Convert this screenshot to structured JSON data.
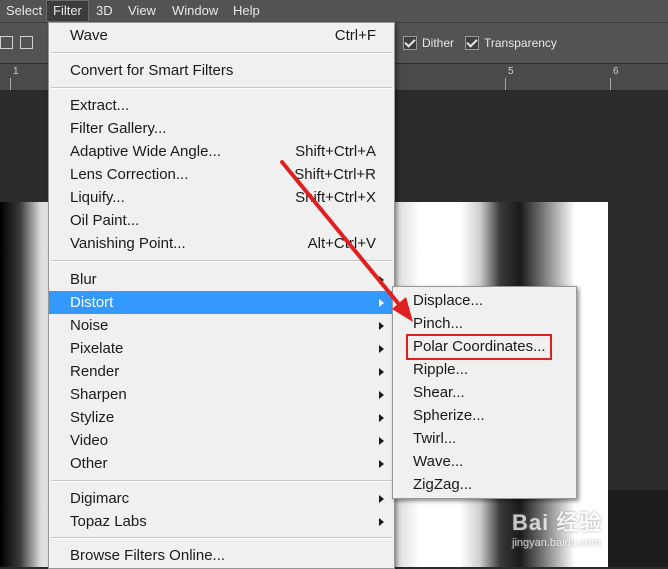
{
  "menubar": {
    "items": [
      {
        "label": "Select"
      },
      {
        "label": "Filter"
      },
      {
        "label": "3D"
      },
      {
        "label": "View"
      },
      {
        "label": "Window"
      },
      {
        "label": "Help"
      }
    ]
  },
  "options": {
    "dither_label": "Dither",
    "transparency_label": "Transparency",
    "dither_checked": true,
    "transparency_checked": true
  },
  "ruler": {
    "labels": [
      "1",
      "5",
      "6"
    ]
  },
  "filter_menu": {
    "items": [
      {
        "label": "Wave",
        "shortcut": "Ctrl+F"
      },
      {
        "label": "Convert for Smart Filters"
      },
      {
        "label": "Extract..."
      },
      {
        "label": "Filter Gallery..."
      },
      {
        "label": "Adaptive Wide Angle...",
        "shortcut": "Shift+Ctrl+A"
      },
      {
        "label": "Lens Correction...",
        "shortcut": "Shift+Ctrl+R"
      },
      {
        "label": "Liquify...",
        "shortcut": "Shift+Ctrl+X"
      },
      {
        "label": "Oil Paint..."
      },
      {
        "label": "Vanishing Point...",
        "shortcut": "Alt+Ctrl+V"
      },
      {
        "label": "Blur"
      },
      {
        "label": "Distort"
      },
      {
        "label": "Noise"
      },
      {
        "label": "Pixelate"
      },
      {
        "label": "Render"
      },
      {
        "label": "Sharpen"
      },
      {
        "label": "Stylize"
      },
      {
        "label": "Video"
      },
      {
        "label": "Other"
      },
      {
        "label": "Digimarc"
      },
      {
        "label": "Topaz Labs"
      },
      {
        "label": "Browse Filters Online..."
      }
    ]
  },
  "distort_submenu": {
    "items": [
      {
        "label": "Displace..."
      },
      {
        "label": "Pinch..."
      },
      {
        "label": "Polar Coordinates..."
      },
      {
        "label": "Ripple..."
      },
      {
        "label": "Shear..."
      },
      {
        "label": "Spherize..."
      },
      {
        "label": "Twirl..."
      },
      {
        "label": "Wave..."
      },
      {
        "label": "ZigZag..."
      }
    ]
  },
  "watermark": {
    "text": "Bai 经验",
    "sub": "jingyan.baidu.com"
  },
  "colors": {
    "highlight": "#3399ff",
    "annotation": "#e02020"
  }
}
